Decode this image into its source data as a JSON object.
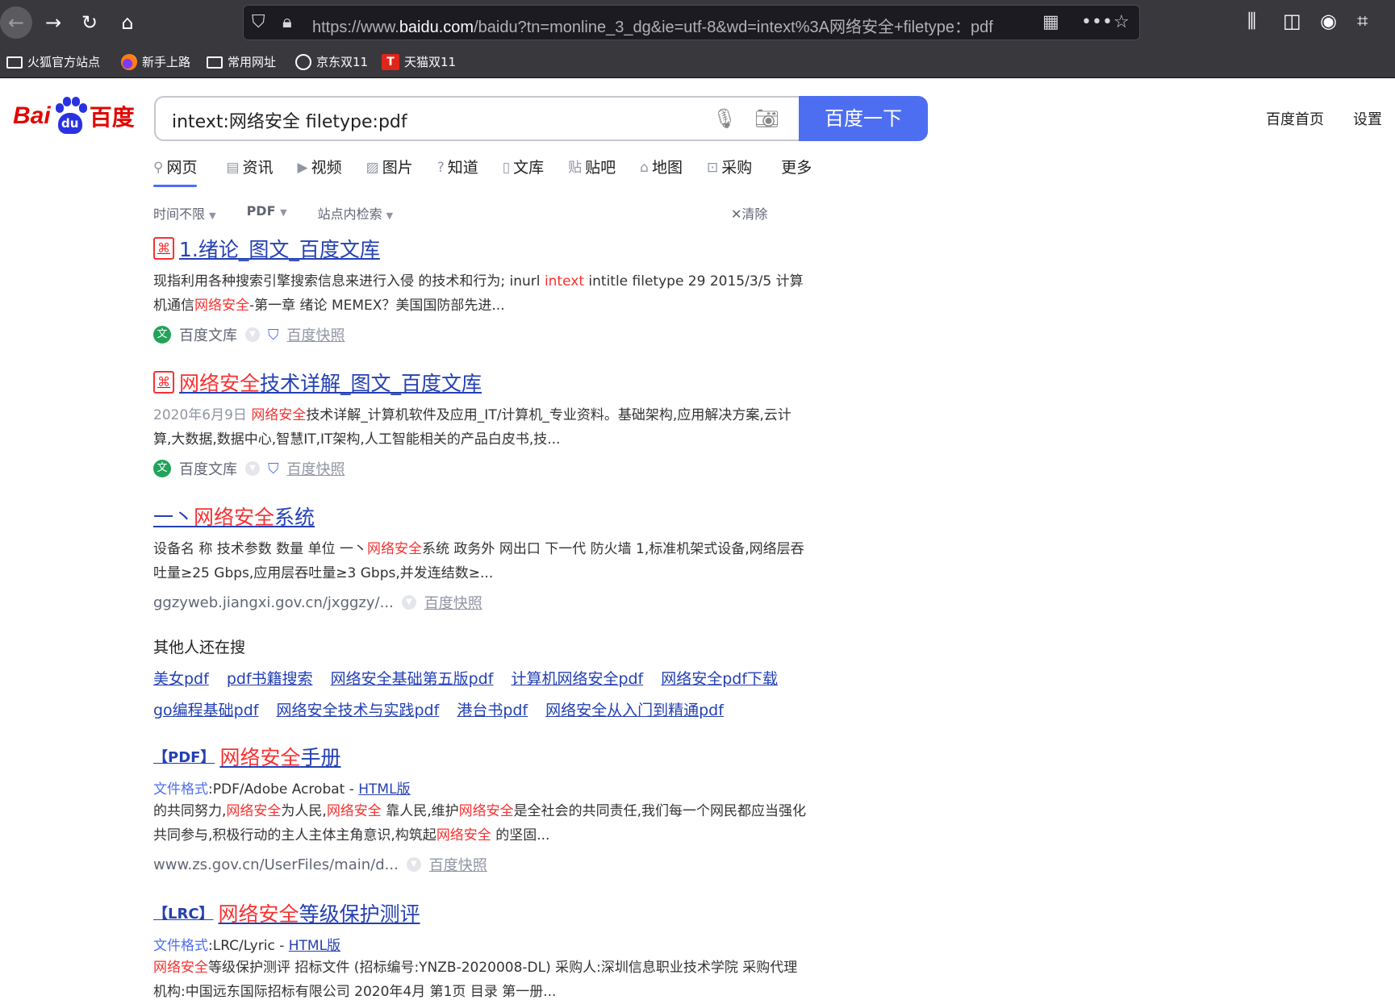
{
  "browser": {
    "url_prefix": "https://www.",
    "url_domain": "baidu.com",
    "url_rest": "/baidu?tn=monline_3_dg&ie=utf-8&wd=intext%3A网络安全+filetype：pdf"
  },
  "bookmarks": [
    "火狐官方站点",
    "新手上路",
    "常用网址",
    "京东双11",
    "天猫双11"
  ],
  "logo": {
    "bai": "Bai",
    "du": "du",
    "cn": "百度"
  },
  "search": {
    "query": "intext:网络安全 filetype:pdf",
    "button": "百度一下"
  },
  "top_links": {
    "home": "百度首页",
    "settings": "设置"
  },
  "tabs": [
    "网页",
    "资讯",
    "视频",
    "图片",
    "知道",
    "文库",
    "贴吧",
    "地图",
    "采购",
    "更多"
  ],
  "filters": {
    "time": "时间不限",
    "type": "PDF",
    "site": "站点内检索",
    "clear": "清除"
  },
  "results": [
    {
      "title": "1.绪论_图文_百度文库",
      "abs_a": "现指利用各种搜索引擎搜索信息来进行入侵 的技术和行为; inurl ",
      "abs_hl1": "intext",
      "abs_b": " intitle filetype 29 2015/3/5 计算机通信",
      "abs_hl2": "网络安全",
      "abs_c": "-第一章 绪论 MEMEX？美国国防部先进...",
      "source": "百度文库",
      "snapshot": "百度快照"
    },
    {
      "title_hl": "网络安全",
      "title_rest": "技术详解_图文_百度文库",
      "date": "2020年6月9日",
      "abs_hl": "网络安全",
      "abs_rest": "技术详解_计算机软件及应用_IT/计算机_专业资料。基础架构,应用解决方案,云计算,大数据,数据中心,智慧IT,IT架构,人工智能相关的产品白皮书,技...",
      "source": "百度文库",
      "snapshot": "百度快照"
    },
    {
      "title_a": "一丶",
      "title_hl": "网络安全",
      "title_b": "系统",
      "abs_a": "设备名 称 技术参数 数量 单位 一丶",
      "abs_hl": "网络安全",
      "abs_b": "系统 政务外 网出口 下一代 防火墙 1,标准机架式设备,网络层吞吐量≥25 Gbps,应用层吞吐量≥3 Gbps,并发连结数≥...",
      "url": "ggzyweb.jiangxi.gov.cn/jxggzy/...",
      "snapshot": "百度快照"
    },
    {
      "tag": "【PDF】",
      "title_hl": "网络安全",
      "title_rest": "手册",
      "fmt_label": "文件格式",
      "fmt_value": ":PDF/Adobe Acrobat - ",
      "fmt_link": "HTML版",
      "abs_a": "的共同努力,",
      "abs_hl1": "网络安全",
      "abs_b": "为人民,",
      "abs_hl2": "网络安全",
      "abs_c": " 靠人民,维护",
      "abs_hl3": "网络安全",
      "abs_d": "是全社会的共同责任,我们每一个网民都应当强化共同参与,积极行动的主人主体主角意识,构筑起",
      "abs_hl4": "网络安全",
      "abs_e": " 的坚固...",
      "url": "www.zs.gov.cn/UserFiles/main/d...",
      "snapshot": "百度快照"
    },
    {
      "tag": "【LRC】",
      "title_hl": "网络安全",
      "title_rest": "等级保护测评",
      "fmt_label": "文件格式",
      "fmt_value": ":LRC/Lyric - ",
      "fmt_link": "HTML版",
      "abs_hl": "网络安全",
      "abs_rest": "等级保护测评 招标文件 (招标编号:YNZB-2020008-DL) 采购人:深圳信息职业技术学院 采购代理机构:中国远东国际招标有限公司 2020年4月 第1页 目录 第一册..."
    }
  ],
  "related": {
    "title": "其他人还在搜",
    "row1": [
      "美女pdf",
      "pdf书籍搜索",
      "网络安全基础第五版pdf",
      "计算机网络安全pdf",
      "网络安全pdf下载"
    ],
    "row2": [
      "go编程基础pdf",
      "网络安全技术与实践pdf",
      "港台书pdf",
      "网络安全从入门到精通pdf"
    ]
  }
}
